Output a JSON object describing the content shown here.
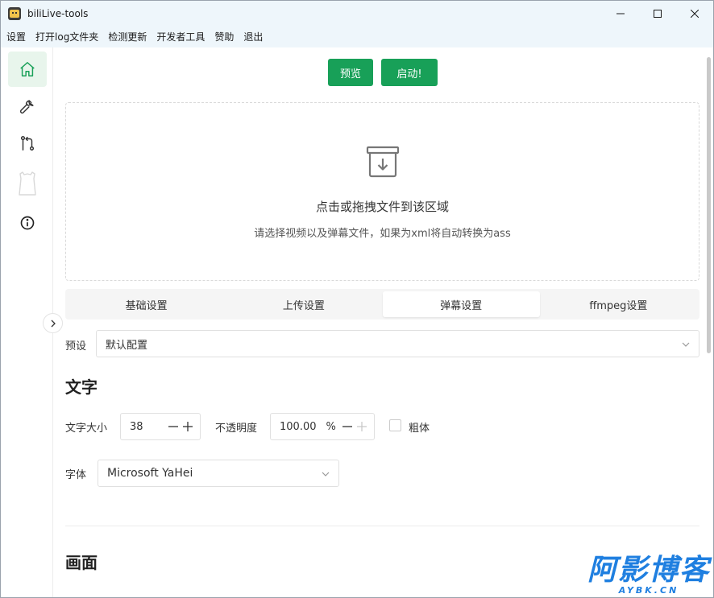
{
  "window": {
    "title": "biliLive-tools"
  },
  "menu": [
    "设置",
    "打开log文件夹",
    "检测更新",
    "开发者工具",
    "赞助",
    "退出"
  ],
  "sidebar": {
    "icons": [
      "home-icon",
      "wrench-icon",
      "git-compare-icon",
      "bilibili-tv-icon",
      "info-icon"
    ]
  },
  "toolbar": {
    "preview_label": "预览",
    "start_label": "启动!"
  },
  "dropzone": {
    "title": "点击或拖拽文件到该区域",
    "subtitle": "请选择视频以及弹幕文件，如果为xml将自动转换为ass"
  },
  "tabs": [
    {
      "label": "基础设置",
      "active": false
    },
    {
      "label": "上传设置",
      "active": false
    },
    {
      "label": "弹幕设置",
      "active": true
    },
    {
      "label": "ffmpeg设置",
      "active": false
    }
  ],
  "preset": {
    "label": "预设",
    "value": "默认配置"
  },
  "text_section": {
    "title": "文字",
    "font_size_label": "文字大小",
    "font_size_value": "38",
    "opacity_label": "不透明度",
    "opacity_value": "100.00",
    "opacity_unit": "%",
    "bold_label": "粗体",
    "font_label": "字体",
    "font_value": "Microsoft YaHei"
  },
  "picture_section": {
    "title": "画面"
  },
  "watermark": {
    "main": "阿影博客",
    "sub": "AYBK.CN"
  },
  "colors": {
    "accent": "#18a058",
    "active_sidebar_bg": "#e8f5ec",
    "watermark": "#1f7fe0"
  }
}
